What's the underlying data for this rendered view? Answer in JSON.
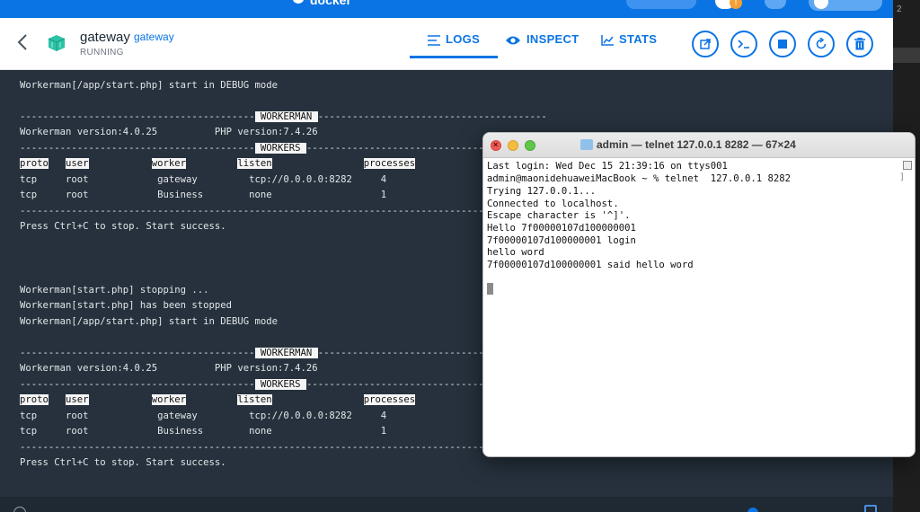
{
  "docker_bar": {
    "brand": "docker",
    "notification_count": "!"
  },
  "header": {
    "container_name": "gateway",
    "image_name": "gateway",
    "status": "RUNNING",
    "tabs": [
      {
        "label": "LOGS",
        "icon": "list-icon"
      },
      {
        "label": "INSPECT",
        "icon": "eye-icon"
      },
      {
        "label": "STATS",
        "icon": "chart-icon"
      }
    ],
    "actions": [
      "open-in-browser-icon",
      "cli-icon",
      "stop-icon",
      "restart-icon",
      "delete-icon"
    ],
    "accent_color": "#0b74e4"
  },
  "logs": [
    {
      "text": "Workerman[/app/start.php] start in DEBUG mode"
    },
    {
      "text": ""
    },
    {
      "text": "----------------------------------------- WORKERMAN -----------------------------------------"
    },
    {
      "text": "Workerman version:4.0.25          PHP version:7.4.26"
    },
    {
      "text": "------------------------------------------ WORKERS ------------------------------------------"
    },
    {
      "text": "proto   user            worker          listen                 processes    status"
    },
    {
      "text": "tcp     root            gateway         tcp://0.0.0.0:8282     4             [OK]"
    },
    {
      "text": "tcp     root            Business        none                   1             [OK]"
    },
    {
      "text": "---------------------------------------------------------------------------------------------"
    },
    {
      "text": "Press Ctrl+C to stop. Start success."
    },
    {
      "text": ""
    },
    {
      "text": ""
    },
    {
      "text": ""
    },
    {
      "text": "Workerman[start.php] stopping ..."
    },
    {
      "text": "Workerman[start.php] has been stopped"
    },
    {
      "text": "Workerman[/app/start.php] start in DEBUG mode"
    },
    {
      "text": ""
    },
    {
      "text": "----------------------------------------- WORKERMAN -----------------------------------------"
    },
    {
      "text": "Workerman version:4.0.25          PHP version:7.4.26"
    },
    {
      "text": "------------------------------------------ WORKERS ------------------------------------------"
    },
    {
      "text": "proto   user            worker          listen                 processes    status"
    },
    {
      "text": "tcp     root            gateway         tcp://0.0.0.0:8282     4             [OK]"
    },
    {
      "text": "tcp     root            Business        none                   1             [OK]"
    },
    {
      "text": "---------------------------------------------------------------------------------------------"
    },
    {
      "text": "Press Ctrl+C to stop. Start success."
    }
  ],
  "log_parts": {
    "dash_left_wm": "-----------------------------------------",
    "workerman_label": "WORKERMAN",
    "dash_right_wm": "----------------------------------------",
    "dash_left_wk": "-----------------------------------------",
    "workers_label": "WORKERS",
    "dash_right_wk": "-----------------------------------------",
    "dash_full": "-----------------------------------------------------------------------------------------",
    "col_proto": "proto",
    "col_user": "user",
    "col_worker": "worker",
    "col_listen": "listen",
    "col_processes": "processes",
    "row1": "tcp     root            gateway         tcp://0.0.0.0:8282     4",
    "row2": "tcp     root            Business        none                   1"
  },
  "terminal": {
    "title": "admin — telnet 127.0.0.1 8282 — 67×24",
    "lines": [
      "Last login: Wed Dec 15 21:39:16 on ttys001",
      "admin@maonidehuaweiMacBook ~ % telnet  127.0.0.1 8282",
      "Trying 127.0.0.1...",
      "Connected to localhost.",
      "Escape character is '^]'.",
      "Hello 7f00000107d100000001",
      "7f00000107d100000001 login",
      "hello word",
      "7f00000107d100000001 said hello word"
    ]
  },
  "editor_side": {
    "line_number": "2"
  }
}
